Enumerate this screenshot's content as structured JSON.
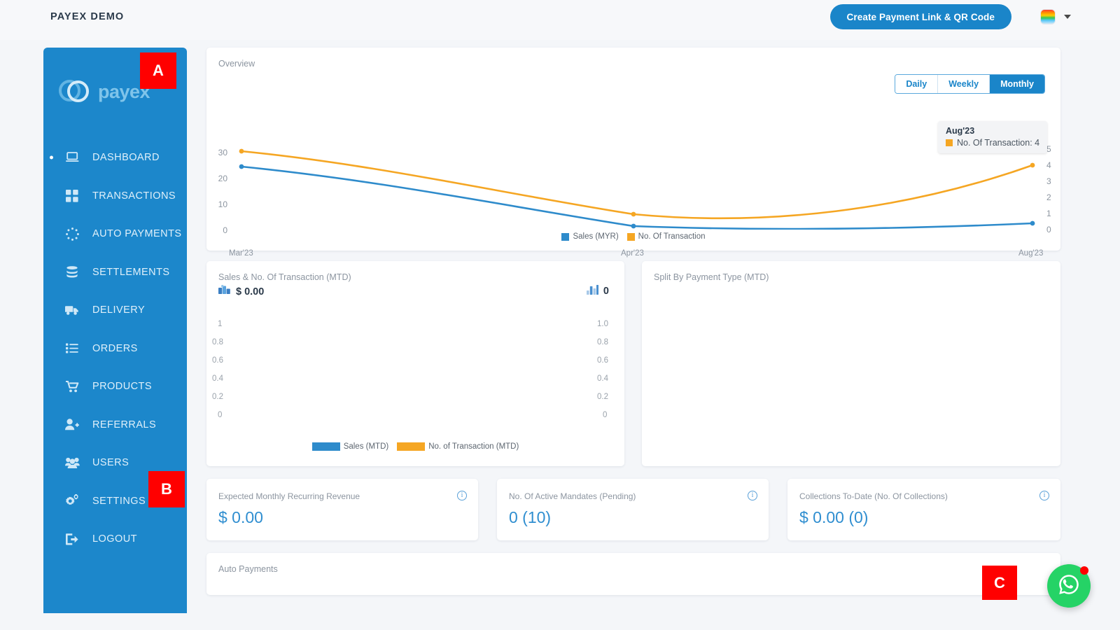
{
  "header": {
    "title": "PAYEX DEMO",
    "create_button": "Create Payment Link & QR Code",
    "avatar_icon": "avatar-image",
    "caret_icon": "chevron-down-icon"
  },
  "sidebar": {
    "logo_text": "payex",
    "items": [
      {
        "label": "DASHBOARD",
        "icon": "laptop-icon",
        "active": true
      },
      {
        "label": "TRANSACTIONS",
        "icon": "grid-icon",
        "active": false
      },
      {
        "label": "AUTO PAYMENTS",
        "icon": "dotted-circle-icon",
        "active": false
      },
      {
        "label": "SETTLEMENTS",
        "icon": "database-icon",
        "active": false
      },
      {
        "label": "DELIVERY",
        "icon": "truck-icon",
        "active": false
      },
      {
        "label": "ORDERS",
        "icon": "list-icon",
        "active": false
      },
      {
        "label": "PRODUCTS",
        "icon": "cart-icon",
        "active": false
      },
      {
        "label": "REFERRALS",
        "icon": "user-plus-icon",
        "active": false
      },
      {
        "label": "USERS",
        "icon": "users-icon",
        "active": false
      },
      {
        "label": "SETTINGS",
        "icon": "gears-icon",
        "active": false
      },
      {
        "label": "LOGOUT",
        "icon": "logout-icon",
        "active": false
      }
    ]
  },
  "overview": {
    "title": "Overview",
    "range_options": [
      "Daily",
      "Weekly",
      "Monthly"
    ],
    "range_selected": "Monthly",
    "tooltip": {
      "title": "Aug'23",
      "series_label": "No. Of Transaction: 4",
      "swatch_color": "#f5a623"
    }
  },
  "mtd": {
    "title": "Sales & No. Of Transaction (MTD)",
    "sales_value": "$ 0.00",
    "sales_icon": "money-stack-icon",
    "transactions_value": "0",
    "transactions_icon": "bar-chart-icon"
  },
  "split": {
    "title": "Split By Payment Type (MTD)"
  },
  "stats": [
    {
      "label": "Expected Monthly Recurring Revenue",
      "value": "$ 0.00",
      "info_icon": "info-icon"
    },
    {
      "label": "No. Of Active Mandates (Pending)",
      "value": "0 (10)",
      "info_icon": "info-icon"
    },
    {
      "label": "Collections To-Date (No. Of Collections)",
      "value": "$ 0.00 (0)",
      "info_icon": "info-icon"
    }
  ],
  "auto_payments": {
    "title": "Auto Payments"
  },
  "floating": {
    "whatsapp_icon": "whatsapp-icon",
    "badge": ""
  },
  "markers": {
    "a": "A",
    "b": "B",
    "c": "C"
  },
  "colors": {
    "brand_blue": "#1a85c9",
    "sidebar_blue": "#1c87cb",
    "sales_blue": "#2e8bcb",
    "transaction_orange": "#f5a623",
    "whatsapp_green": "#25d366",
    "marker_red": "#ff0000"
  },
  "chart_data": [
    {
      "type": "line",
      "title": "Overview",
      "x": [
        "Mar'23",
        "Apr'23",
        "Aug'23"
      ],
      "xlabel": "",
      "grid": false,
      "legend_position": "bottom",
      "y_left": {
        "label": "Sales (MYR)",
        "ticks": [
          0,
          10,
          20,
          30
        ],
        "ylim": [
          0,
          33
        ]
      },
      "y_right": {
        "label": "No. Of Transaction",
        "ticks": [
          0,
          1,
          2,
          3,
          4,
          5
        ],
        "ylim": [
          0,
          5.5
        ]
      },
      "series": [
        {
          "name": "Sales (MYR)",
          "axis": "left",
          "color": "#2e8bcb",
          "values": [
            24,
            0.5,
            1.5
          ]
        },
        {
          "name": "No. Of Transaction",
          "axis": "right",
          "color": "#f5a623",
          "values": [
            5,
            1.1,
            4
          ]
        }
      ],
      "annotations": [
        {
          "x": "Aug'23",
          "series": "No. Of Transaction",
          "text": "No. Of Transaction: 4"
        }
      ]
    },
    {
      "type": "bar",
      "title": "Sales & No. Of Transaction (MTD)",
      "categories": [],
      "legend_position": "bottom",
      "y_left": {
        "ticks": [
          "0",
          "0.2",
          "0.4",
          "0.6",
          "0.8",
          "1"
        ],
        "ylim": [
          0,
          1
        ]
      },
      "y_right": {
        "ticks": [
          "0",
          "0.2",
          "0.4",
          "0.6",
          "0.8",
          "1.0"
        ],
        "ylim": [
          0,
          1
        ]
      },
      "series": [
        {
          "name": "Sales (MTD)",
          "color": "#2e8bcb",
          "values": []
        },
        {
          "name": "No. of Transaction (MTD)",
          "color": "#f5a623",
          "values": []
        }
      ]
    },
    {
      "type": "pie",
      "title": "Split By Payment Type (MTD)",
      "labels": [],
      "values": []
    }
  ]
}
